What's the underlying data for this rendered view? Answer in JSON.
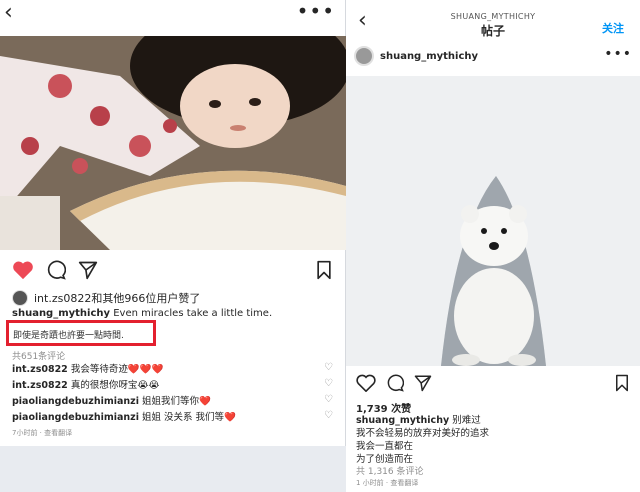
{
  "left": {
    "likes_text": "int.zs0822和其他966位用户赞了",
    "caption_user": "shuang_mythichy",
    "caption_text": "Even miracles take a little time.",
    "caption_cn": "即使是奇蹟也許要一點時間.",
    "comment_count": "共651条评论",
    "comments": [
      {
        "user": "int.zs0822",
        "text": "我会等待奇迹❤️❤️❤️"
      },
      {
        "user": "int.zs0822",
        "text": "真的很想你呀宝😭😭"
      },
      {
        "user": "piaoliangdebuzhimianzi",
        "text": "姐姐我们等你❤️"
      },
      {
        "user": "piaoliangdebuzhimianzi",
        "text": "姐姐 没关系 我们等❤️"
      }
    ],
    "time": "7小时前 · 查看翻译",
    "colors": {
      "like": "#ed4956",
      "highlight": "#e3202f"
    }
  },
  "right": {
    "header_user": "SHUANG_MYTHICHY",
    "header_title": "帖子",
    "follow_label": "关注",
    "post_user": "shuang_mythichy",
    "likes": "1,739 次赞",
    "caption_user": "shuang_mythichy",
    "caption_lines": [
      "别难过",
      "我不会轻易的放弃对美好的追求",
      "我会一直都在",
      "为了创造而在"
    ],
    "comment_count": "共 1,316 条评论",
    "time": "1 小时前 · 查看翻译",
    "colors": {
      "follow": "#0095f6"
    }
  }
}
